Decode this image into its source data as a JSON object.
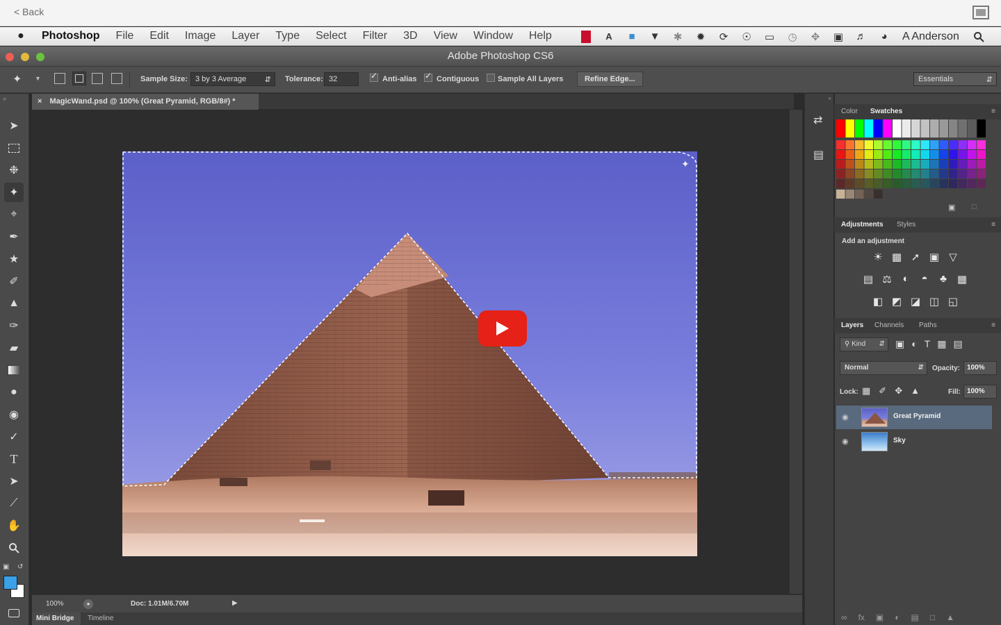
{
  "topbar": {
    "back_label": "< Back"
  },
  "menubar": {
    "app_name": "Photoshop",
    "items": [
      "File",
      "Edit",
      "Image",
      "Layer",
      "Type",
      "Select",
      "Filter",
      "3D",
      "View",
      "Window",
      "Help"
    ],
    "status_icons": [
      "adobe-icon",
      "aa-icon",
      "box-icon",
      "bell-icon",
      "snowflake-icon",
      "gear-cluster-icon",
      "sync-icon",
      "accessibility-icon",
      "display-icon",
      "clock-icon",
      "move-icon",
      "window-icon",
      "volume-icon",
      "history-icon"
    ],
    "user_name": "A Anderson"
  },
  "window": {
    "title": "Adobe Photoshop CS6"
  },
  "options_bar": {
    "sample_size_label": "Sample Size:",
    "sample_size_value": "3 by 3 Average",
    "tolerance_label": "Tolerance:",
    "tolerance_value": "32",
    "anti_alias_label": "Anti-alias",
    "contiguous_label": "Contiguous",
    "sample_all_label": "Sample All Layers",
    "refine_edge_label": "Refine Edge...",
    "workspace_value": "Essentials"
  },
  "document": {
    "tab_label": "MagicWand.psd @ 100% (Great Pyramid, RGB/8#) *"
  },
  "status_bar": {
    "zoom": "100%",
    "doc_size": "Doc: 1.01M/6.70M",
    "bottom_tabs": [
      "Mini Bridge",
      "Timeline"
    ]
  },
  "panels": {
    "color_tabs": [
      "Color",
      "Swatches"
    ],
    "adjust_tabs": [
      "Adjustments",
      "Styles"
    ],
    "add_adjustment_label": "Add an adjustment",
    "layers_tabs": [
      "Layers",
      "Channels",
      "Paths"
    ],
    "kind_label": "Kind",
    "blend_mode": "Normal",
    "opacity_label": "Opacity:",
    "opacity_value": "100%",
    "lock_label": "Lock:",
    "fill_label": "Fill:",
    "fill_value": "100%",
    "layers": [
      {
        "name": "Great Pyramid",
        "selected": true
      },
      {
        "name": "Sky",
        "selected": false
      }
    ]
  },
  "colors": {
    "ps_bg": "#2b2b2b",
    "selected_layer": "#5a6a7e",
    "play_red": "#e62117",
    "fg_swatch": "#3aa0e8",
    "bg_swatch": "#ffffff"
  }
}
